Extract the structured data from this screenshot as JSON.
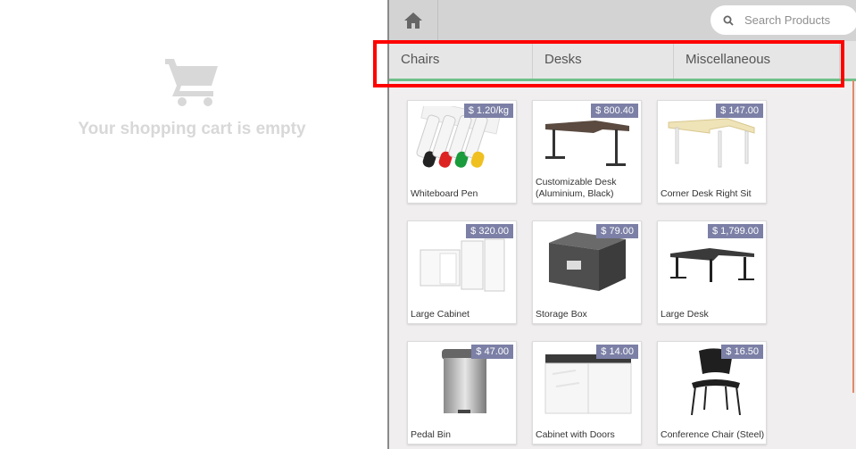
{
  "cart": {
    "icon": "shopping-cart-icon",
    "empty_message": "Your shopping cart is empty"
  },
  "topbar": {
    "home_icon": "home-icon",
    "search": {
      "placeholder": "Search Products",
      "value": "",
      "icon": "search-icon"
    }
  },
  "categories": [
    {
      "label": "Chairs"
    },
    {
      "label": "Desks"
    },
    {
      "label": "Miscellaneous"
    }
  ],
  "products": [
    {
      "name": "Whiteboard Pen",
      "price": "$ 1.20/kg",
      "image": "whiteboard-pen"
    },
    {
      "name": "Customizable Desk (Aluminium, Black)",
      "price": "$ 800.40",
      "image": "desk"
    },
    {
      "name": "Corner Desk Right Sit",
      "price": "$ 147.00",
      "image": "corner-desk"
    },
    {
      "name": "Large Cabinet",
      "price": "$ 320.00",
      "image": "cabinet"
    },
    {
      "name": "Storage Box",
      "price": "$ 79.00",
      "image": "storage-box"
    },
    {
      "name": "Large Desk",
      "price": "$ 1,799.00",
      "image": "large-desk"
    },
    {
      "name": "Pedal Bin",
      "price": "$ 47.00",
      "image": "pedal-bin"
    },
    {
      "name": "Cabinet with Doors",
      "price": "$ 14.00",
      "image": "cabinet-doors"
    },
    {
      "name": "Conference Chair (Steel)",
      "price": "$ 16.50",
      "image": "conference-chair"
    }
  ],
  "colors": {
    "price_badge": "#7c80a6",
    "highlight": "#ff0000",
    "category_underline": "#6ec089"
  }
}
